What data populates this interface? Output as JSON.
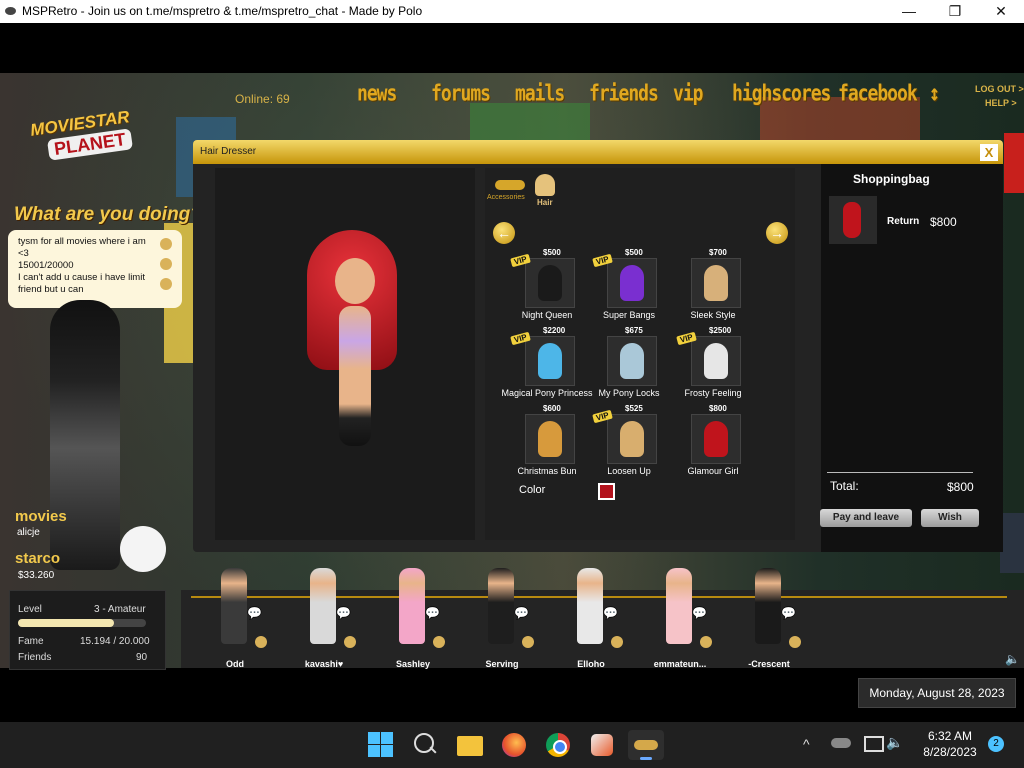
{
  "window": {
    "title": "MSPRetro - Join us on t.me/mspretro & t.me/mspretro_chat - Made by Polo",
    "minimize": "—",
    "maximize": "❐",
    "close": "✕"
  },
  "header": {
    "online": "Online: 69",
    "nav": [
      "news",
      "forums",
      "mails",
      "friends",
      "vip",
      "highscores",
      "facebook"
    ],
    "sort_glyph": "↕",
    "logout": "LOG OUT >",
    "help": "HELP >"
  },
  "logo": {
    "line1": "MOVIESTAR",
    "line2": "PLANET"
  },
  "left": {
    "what_doing": "What are you doing?",
    "status_lines": [
      "tysm for all movies where i am <3",
      "15001/20000",
      "I can't add u cause i have limit friend but u can"
    ],
    "movies_label": "movies",
    "username": "alicje",
    "starcoins_label": "starco",
    "starcoins": "$33.260"
  },
  "stats": {
    "level_label": "Level",
    "level_value": "3 - Amateur",
    "level_progress": 0.75,
    "fame_label": "Fame",
    "fame_value": "15.194 / 20.000",
    "friends_label": "Friends",
    "friends_value": "90"
  },
  "hair_dresser": {
    "title": "Hair Dresser",
    "close": "X",
    "tabs": {
      "accessories": "Accessories",
      "hair": "Hair"
    },
    "prev": "←",
    "next": "→",
    "color_label": "Color",
    "selected_color": "#b3121c",
    "items": [
      {
        "name": "Night Queen",
        "price": "$500",
        "vip": true,
        "color": "#1a1a1a"
      },
      {
        "name": "Super Bangs",
        "price": "$500",
        "vip": true,
        "color": "#7a2fd0"
      },
      {
        "name": "Sleek Style",
        "price": "$700",
        "vip": false,
        "color": "#d7b07a"
      },
      {
        "name": "Magical Pony Princess",
        "price": "$2200",
        "vip": true,
        "color": "#4db6e8"
      },
      {
        "name": "My Pony Locks",
        "price": "$675",
        "vip": false,
        "color": "#aac8d8"
      },
      {
        "name": "Frosty Feeling",
        "price": "$2500",
        "vip": true,
        "color": "#e6e6e6"
      },
      {
        "name": "Christmas Bun",
        "price": "$600",
        "vip": false,
        "color": "#d79a3c"
      },
      {
        "name": "Loosen Up",
        "price": "$525",
        "vip": true,
        "color": "#d8ae6e"
      },
      {
        "name": "Glamour Girl",
        "price": "$800",
        "vip": false,
        "color": "#c0141c"
      }
    ]
  },
  "bag": {
    "title": "Shoppingbag",
    "item_action": "Return",
    "item_price": "$800",
    "item_color": "#c0141c",
    "total_label": "Total:",
    "total_value": "$800",
    "pay_button": "Pay and leave",
    "wish_button": "Wish"
  },
  "friends": [
    {
      "name": "Odd",
      "color": "#3a3a3a"
    },
    {
      "name": "kavashi♥",
      "color": "#d9d9d9"
    },
    {
      "name": "Sashley",
      "color": "#f3a6c8"
    },
    {
      "name": "Serving",
      "color": "#1e1e1e"
    },
    {
      "name": "Elloho",
      "color": "#e8e8e8"
    },
    {
      "name": "emmateun...",
      "color": "#f6c3c8"
    },
    {
      "name": "-Crescent",
      "color": "#1a1a1a"
    }
  ],
  "datetip": "Monday, August 28, 2023",
  "taskbar": {
    "time": "6:32 AM",
    "date": "8/28/2023",
    "notifications": "2"
  }
}
